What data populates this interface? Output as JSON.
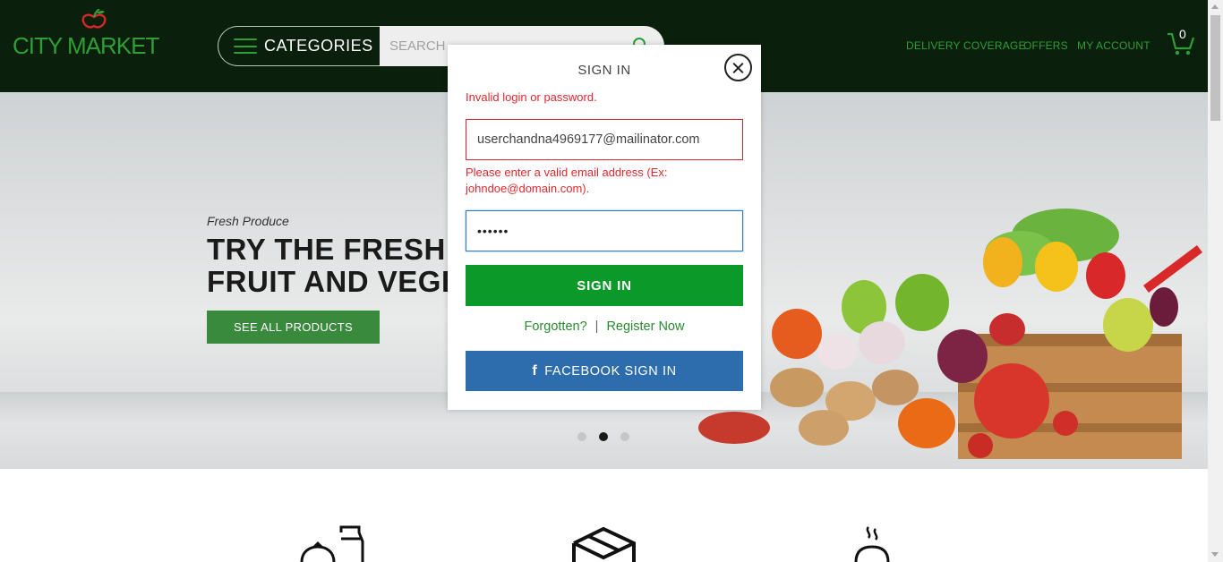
{
  "header": {
    "logo_text": "CITY MARKET",
    "categories_label": "CATEGORIES",
    "search_placeholder": "SEARCH",
    "nav": {
      "delivery": "DELIVERY COVERAGE",
      "offers": "OFFERS",
      "account": "MY ACCOUNT"
    },
    "cart_count": "0"
  },
  "hero": {
    "kicker": "Fresh Produce",
    "title_line1": "TRY THE FRESHE",
    "title_line2": "FRUIT AND VEGE",
    "button_label": "SEE ALL PRODUCTS",
    "slides": 3,
    "active_slide": 2
  },
  "modal": {
    "title": "SIGN IN",
    "error_general": "Invalid login or password.",
    "email_value": "userchandna4969177@mailinator.com",
    "email_error": "Please enter a valid email address (Ex: johndoe@domain.com).",
    "password_value": "••••••",
    "signin_label": "SIGN IN",
    "forgotten_label": "Forgotten?",
    "separator": "|",
    "register_label": "Register Now",
    "facebook_label": "FACEBOOK SIGN IN",
    "facebook_icon": "f"
  },
  "colors": {
    "header_bg": "#0a1f0c",
    "brand_green": "#2e9e35",
    "signin_green": "#0b9a2a",
    "facebook_blue": "#2d6dad",
    "error_red": "#e0282e"
  }
}
